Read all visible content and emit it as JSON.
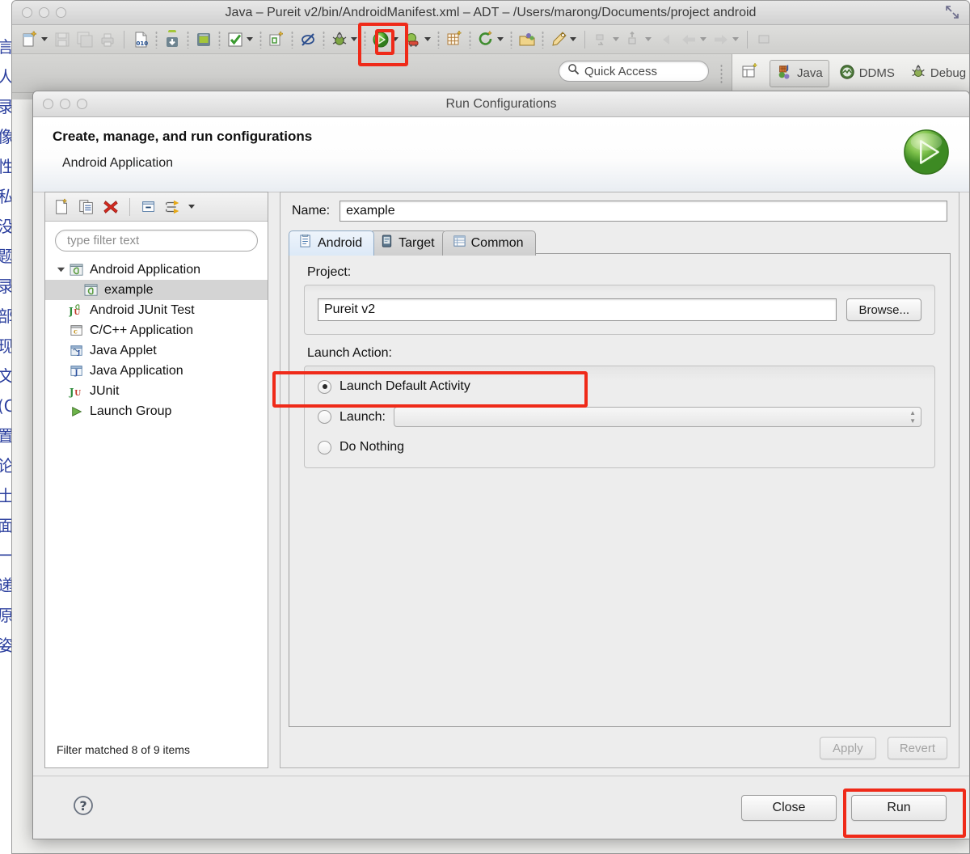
{
  "window": {
    "title": "Java – Pureit v2/bin/AndroidManifest.xml – ADT – /Users/marong/Documents/project android",
    "fullscreen_icon": "fullscreen-arrows-icon",
    "traffic_lights": [
      "close",
      "minimize",
      "zoom"
    ]
  },
  "toolbar": {
    "items": [
      {
        "icon": "new-file-icon",
        "dropdown": true,
        "enabled": true
      },
      {
        "icon": "save-icon",
        "dropdown": false,
        "enabled": false
      },
      {
        "icon": "save-all-icon",
        "dropdown": false,
        "enabled": false
      },
      {
        "icon": "print-icon",
        "dropdown": false,
        "enabled": false
      },
      {
        "icon": "binary-file-010-icon",
        "dropdown": false,
        "enabled": true
      },
      {
        "icon": "android-download-icon",
        "dropdown": false,
        "enabled": true
      },
      {
        "icon": "android-sdk-manager-icon",
        "dropdown": false,
        "enabled": true
      },
      {
        "icon": "checkmark-icon",
        "dropdown": true,
        "enabled": true
      },
      {
        "icon": "new-android-project-icon",
        "dropdown": false,
        "enabled": true
      },
      {
        "icon": "skip-breakpoints-icon",
        "dropdown": false,
        "enabled": true
      },
      {
        "icon": "debug-bug-icon",
        "dropdown": true,
        "enabled": true
      },
      {
        "icon": "run-play-icon",
        "dropdown": true,
        "enabled": true
      },
      {
        "icon": "external-tools-icon",
        "dropdown": true,
        "enabled": true
      },
      {
        "icon": "new-layout-icon",
        "dropdown": false,
        "enabled": true
      },
      {
        "icon": "refresh-new-icon",
        "dropdown": true,
        "enabled": true
      },
      {
        "icon": "open-package-icon",
        "dropdown": false,
        "enabled": true
      },
      {
        "icon": "search-pen-icon",
        "dropdown": true,
        "enabled": true
      },
      {
        "icon": "next-annotation-icon",
        "dropdown": true,
        "enabled": false
      },
      {
        "icon": "previous-annotation-icon",
        "dropdown": true,
        "enabled": false
      },
      {
        "icon": "back-history-icon",
        "dropdown": false,
        "enabled": false
      },
      {
        "icon": "back-arrow-icon",
        "dropdown": true,
        "enabled": false
      },
      {
        "icon": "forward-arrow-icon",
        "dropdown": true,
        "enabled": false
      },
      {
        "icon": "pin-editor-icon",
        "dropdown": false,
        "enabled": false
      }
    ]
  },
  "quick_access": {
    "placeholder": "Quick Access",
    "icon": "search-icon"
  },
  "perspectives": {
    "open_perspective_icon": "open-perspective-icon",
    "items": [
      {
        "label": "Java",
        "icon": "java-perspective-icon",
        "active": true
      },
      {
        "label": "DDMS",
        "icon": "ddms-perspective-icon",
        "active": false
      },
      {
        "label": "Debug",
        "icon": "debug-perspective-icon",
        "active": false
      }
    ]
  },
  "background_strip": {
    "lines": [
      "言",
      "人",
      "录",
      "像",
      "性",
      "私",
      "没",
      "题",
      "录",
      "部",
      "现",
      "文",
      "(C",
      "置",
      "论",
      "土",
      "面",
      "一",
      "递",
      "原",
      "姿"
    ]
  },
  "dialog": {
    "title": "Run Configurations",
    "header_title": "Create, manage, and run configurations",
    "header_subtitle": "Android Application",
    "header_icon": "run-play-large-icon",
    "tree": {
      "toolbar": [
        {
          "icon": "new-launch-configuration-icon"
        },
        {
          "icon": "duplicate-configuration-icon"
        },
        {
          "icon": "delete-configuration-icon"
        },
        {
          "icon": "collapse-all-icon"
        },
        {
          "icon": "filter-configurations-icon",
          "dropdown": true
        }
      ],
      "filter_placeholder": "type filter text",
      "items": [
        {
          "label": "Android Application",
          "icon": "android-config-icon",
          "level": 0,
          "expanded": true,
          "selected": false
        },
        {
          "label": "example",
          "icon": "android-config-icon",
          "level": 1,
          "expanded": null,
          "selected": true
        },
        {
          "label": "Android JUnit Test",
          "icon": "android-junit-icon",
          "level": 0,
          "expanded": null,
          "selected": false
        },
        {
          "label": "C/C++ Application",
          "icon": "cpp-application-icon",
          "level": 0,
          "expanded": null,
          "selected": false
        },
        {
          "label": "Java Applet",
          "icon": "java-applet-icon",
          "level": 0,
          "expanded": null,
          "selected": false
        },
        {
          "label": "Java Application",
          "icon": "java-application-icon",
          "level": 0,
          "expanded": null,
          "selected": false
        },
        {
          "label": "JUnit",
          "icon": "junit-icon",
          "level": 0,
          "expanded": null,
          "selected": false
        },
        {
          "label": "Launch Group",
          "icon": "launch-group-icon",
          "level": 0,
          "expanded": null,
          "selected": false
        }
      ],
      "footer": "Filter matched 8 of 9 items"
    },
    "config": {
      "name_label": "Name:",
      "name_value": "example",
      "tabs": [
        {
          "label": "Android",
          "icon": "android-tab-icon",
          "active": true
        },
        {
          "label": "Target",
          "icon": "target-tab-icon",
          "active": false
        },
        {
          "label": "Common",
          "icon": "common-tab-icon",
          "active": false
        }
      ],
      "project_label": "Project:",
      "project_value": "Pureit v2",
      "browse_label": "Browse...",
      "launch_action_label": "Launch Action:",
      "radios": [
        {
          "label": "Launch Default Activity",
          "selected": true,
          "has_combo": false
        },
        {
          "label": "Launch:",
          "selected": false,
          "has_combo": true,
          "combo_value": ""
        },
        {
          "label": "Do Nothing",
          "selected": false,
          "has_combo": false
        }
      ],
      "apply_label": "Apply",
      "revert_label": "Revert",
      "apply_enabled": false,
      "revert_enabled": false
    },
    "footer": {
      "help_icon": "help-question-icon",
      "close_label": "Close",
      "run_label": "Run"
    }
  },
  "annotations": {
    "color": "#ef2a19",
    "boxes": [
      {
        "name": "highlight-run-toolbar-button"
      },
      {
        "name": "highlight-launch-default-activity"
      },
      {
        "name": "highlight-run-button"
      }
    ]
  }
}
